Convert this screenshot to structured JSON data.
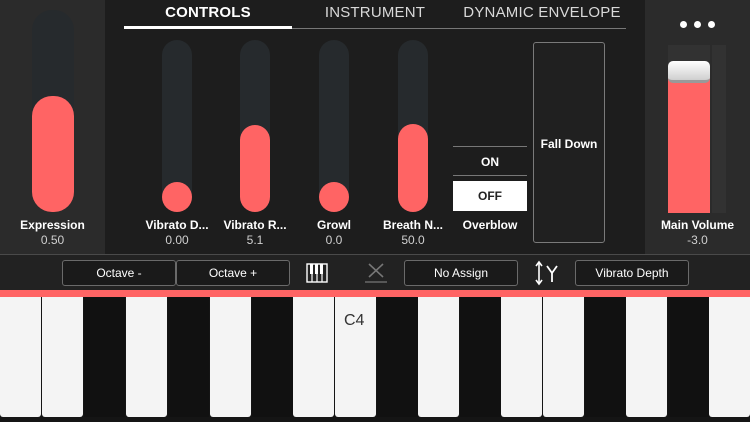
{
  "tabs": [
    {
      "label": "CONTROLS",
      "active": true
    },
    {
      "label": "INSTRUMENT",
      "active": false
    },
    {
      "label": "DYNAMIC ENVELOPE",
      "active": false
    }
  ],
  "expression": {
    "label": "Expression",
    "value": "0.50",
    "level": 0.5
  },
  "sliders": [
    {
      "label": "Vibrato D...",
      "value": "0.00",
      "level": 0.0
    },
    {
      "label": "Vibrato R...",
      "value": "5.1",
      "level": 0.4
    },
    {
      "label": "Growl",
      "value": "0.0",
      "level": 0.0
    },
    {
      "label": "Breath N...",
      "value": "50.0",
      "level": 0.41
    }
  ],
  "overblow": {
    "label": "Overblow",
    "on_label": "ON",
    "off_label": "OFF",
    "selected": "OFF"
  },
  "fall_down": {
    "label": "Fall Down"
  },
  "main_volume": {
    "label": "Main Volume",
    "value": "-3.0",
    "level": 0.82
  },
  "toolbar": {
    "octave_down": "Octave -",
    "octave_up": "Octave +",
    "no_assign": "No Assign",
    "vibrato_depth": "Vibrato Depth"
  },
  "keyboard": {
    "c4_label": "C4"
  },
  "colors": {
    "accent": "#ff6464",
    "background": "#1d1d1d",
    "panel": "#2b2b2b"
  },
  "icons": {
    "more": "more-dots-icon",
    "keyboard": "keyboard-icon",
    "clear": "x-icon",
    "axis": "axis-icon"
  }
}
